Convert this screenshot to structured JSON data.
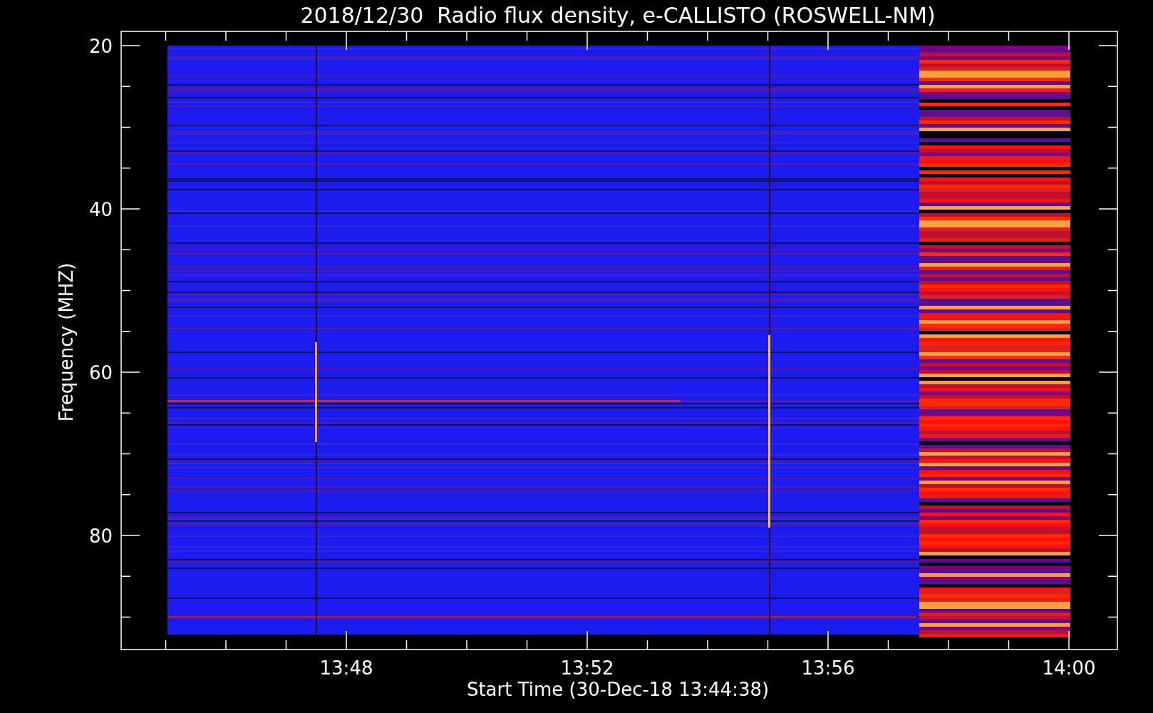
{
  "title": "2018/12/30  Radio flux density, e-CALLISTO (ROSWELL-NM)",
  "y_axis": {
    "label": "Frequency (MHZ)",
    "ticks": [
      "20",
      "40",
      "60",
      "80"
    ]
  },
  "x_axis": {
    "label": "Start Time (30-Dec-18 13:44:38)",
    "ticks": [
      "13:48",
      "13:52",
      "13:56",
      "14:00"
    ]
  }
}
